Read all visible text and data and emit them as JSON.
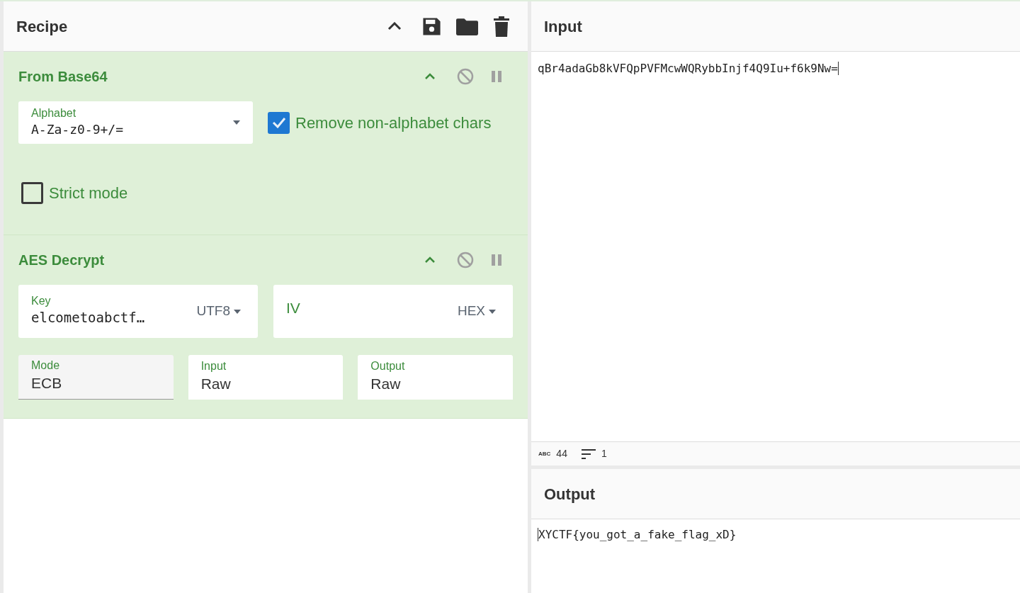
{
  "recipe": {
    "title": "Recipe"
  },
  "operations": [
    {
      "kind": "base64",
      "title": "From Base64",
      "disabled": false,
      "paused": false,
      "alphabet": {
        "label": "Alphabet",
        "value": "A-Za-z0-9+/="
      },
      "remove_non_alphabet": {
        "label": "Remove non-alphabet chars",
        "checked": true
      },
      "strict_mode": {
        "label": "Strict mode",
        "checked": false
      }
    },
    {
      "kind": "aes",
      "title": "AES Decrypt",
      "disabled": false,
      "paused": false,
      "key": {
        "label": "Key",
        "value": "elcometoabctf…",
        "encoding": "UTF8"
      },
      "iv": {
        "label": "IV",
        "encoding": "HEX"
      },
      "mode": {
        "label": "Mode",
        "value": "ECB"
      },
      "input": {
        "label": "Input",
        "value": "Raw"
      },
      "output": {
        "label": "Output",
        "value": "Raw"
      }
    }
  ],
  "input": {
    "title": "Input",
    "value": "qBr4adaGb8kVFQpPVFMcwWQRybbInjf4Q9Iu+f6k9Nw="
  },
  "status_bar": {
    "length_icon": "ABC",
    "length": "44",
    "lines": "1"
  },
  "output": {
    "title": "Output",
    "value": "XYCTF{you_got_a_fake_flag_xD}"
  }
}
